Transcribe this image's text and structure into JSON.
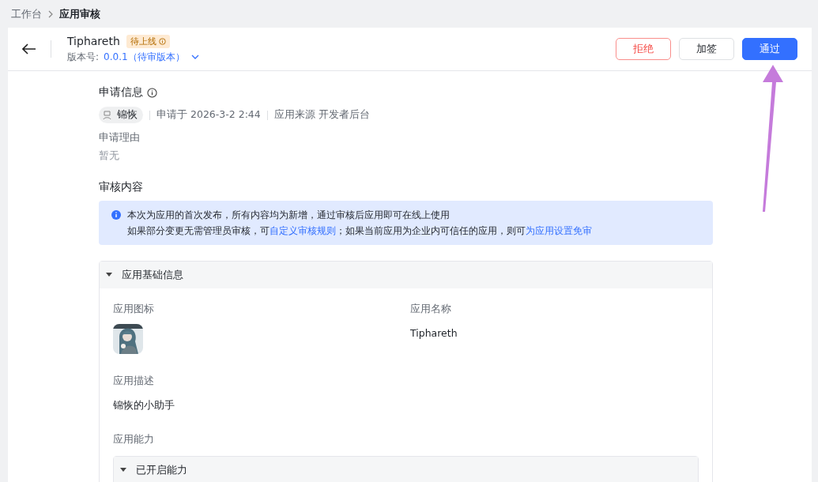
{
  "breadcrumb": [
    {
      "label": "工作台",
      "current": false
    },
    {
      "label": "应用审核",
      "current": true
    }
  ],
  "header": {
    "app_name": "Tiphareth",
    "status": "待上线",
    "version_label": "版本号:",
    "version": "0.0.1（待审版本）",
    "buttons": [
      {
        "label": "拒绝",
        "kind": "danger"
      },
      {
        "label": "加签",
        "kind": "default"
      },
      {
        "label": "通过",
        "kind": "primary"
      }
    ]
  },
  "apply_info": {
    "title": "申请信息",
    "applicant": "锦恢",
    "applied_at": "申请于 2026-3-2 2:44",
    "source": "应用来源 开发者后台",
    "reason_label": "申请理由",
    "reason": "暂无"
  },
  "review": {
    "title": "审核内容",
    "notice_line1": "本次为应用的首次发布，所有内容均为新增，通过审核后应用即可在线上使用",
    "notice_line2": [
      {
        "text": "如果部分变更无需管理员审核，可",
        "link": false
      },
      {
        "text": "自定义审核规则",
        "link": true
      },
      {
        "text": "；如果当前应用为企业内可信任的应用，则可",
        "link": false
      },
      {
        "text": "为应用设置免审",
        "link": true
      }
    ]
  },
  "basic_panel": {
    "title": "应用基础信息",
    "expanded": true,
    "icon_label": "应用图标",
    "name_label": "应用名称",
    "name": "Tiphareth",
    "desc_label": "应用描述",
    "desc": "锦恢的小助手",
    "ability_label": "应用能力",
    "ability_panel": {
      "title": "已开启能力",
      "expanded": true
    }
  }
}
